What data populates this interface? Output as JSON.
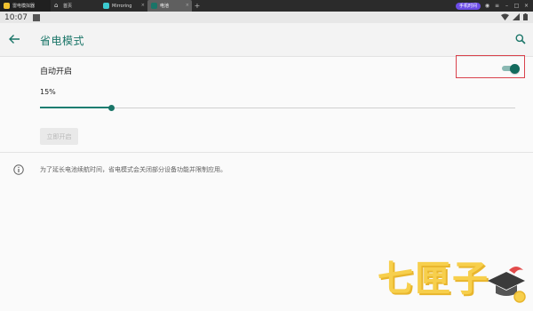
{
  "emulator": {
    "tabs": [
      {
        "label": "雷电模拟器",
        "active": false
      },
      {
        "label": "首页",
        "active": false
      },
      {
        "label": "Mirroring",
        "active": false
      },
      {
        "label": "电池",
        "active": true
      }
    ],
    "account_label": "手机时间"
  },
  "statusbar": {
    "time": "10:07"
  },
  "appbar": {
    "title": "省电模式",
    "back_icon": "arrow-back-icon",
    "search_icon": "search-icon"
  },
  "settings": {
    "auto_on_label": "自动开启",
    "auto_on_enabled": true,
    "threshold_label": "15%",
    "threshold_fraction": 0.15,
    "turn_on_now_label": "立即开启",
    "info_text": "为了延长电池续航时间，省电模式会关闭部分设备功能并限制应用。"
  },
  "colors": {
    "accent": "#1a7568",
    "highlight_box": "#d9434d",
    "watermark": "#f7cf4c"
  },
  "watermark": {
    "text": "七匣子"
  }
}
